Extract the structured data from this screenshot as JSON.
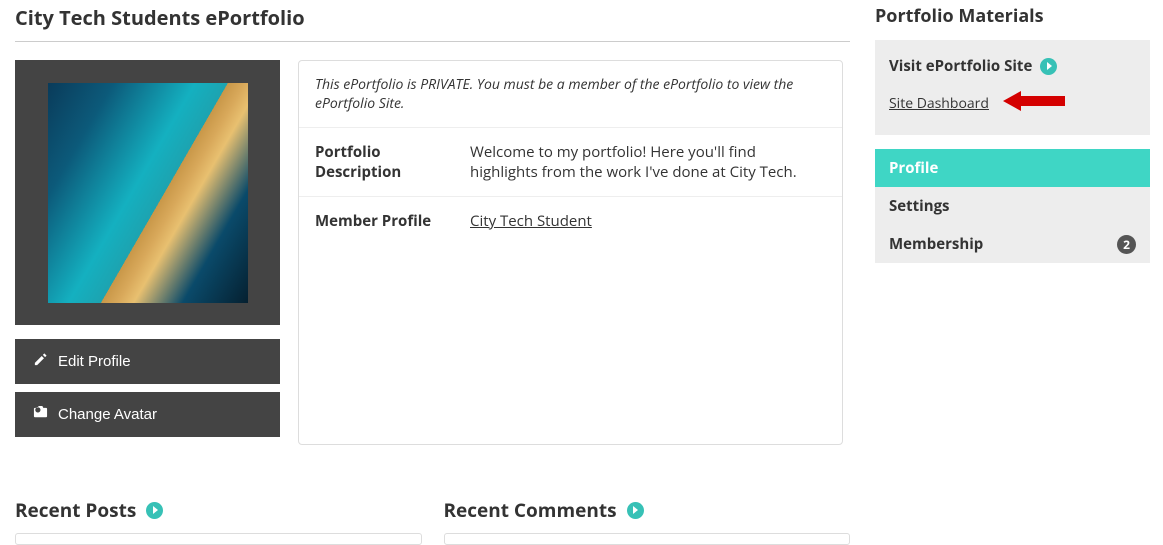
{
  "main": {
    "title": "City Tech Students ePortfolio",
    "private_notice": "This ePortfolio is PRIVATE. You must be a member of the ePortfolio to view the ePortfolio Site.",
    "desc_label": "Portfolio Description",
    "desc_value": "Welcome to my portfolio! Here you'll find highlights from the work I've done at City Tech.",
    "member_label": "Member Profile",
    "member_link": "City Tech Student",
    "edit_profile": "Edit Profile",
    "change_avatar": "Change Avatar",
    "recent_posts": "Recent Posts",
    "recent_comments": "Recent Comments"
  },
  "sidebar": {
    "title": "Portfolio Materials",
    "visit": "Visit ePortfolio Site",
    "dashboard": "Site Dashboard",
    "nav": {
      "profile": "Profile",
      "settings": "Settings",
      "membership": "Membership",
      "membership_count": "2"
    }
  }
}
